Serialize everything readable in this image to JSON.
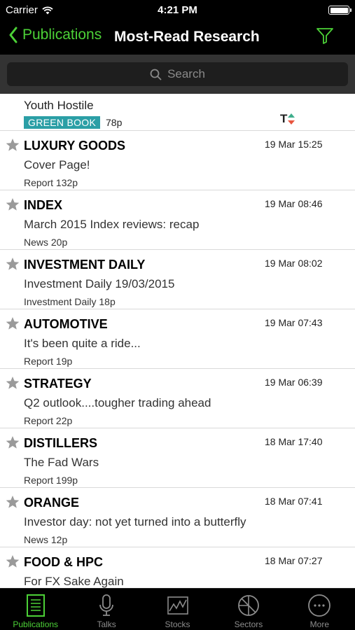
{
  "status_bar": {
    "carrier": "Carrier",
    "time": "4:21 PM"
  },
  "nav": {
    "back_label": "Publications",
    "title": "Most-Read Research"
  },
  "search": {
    "placeholder": "Search"
  },
  "first_item": {
    "title": "Youth Hostile",
    "badge": "GREEN BOOK",
    "pages": "78p",
    "marker": "T"
  },
  "items": [
    {
      "heading": "LUXURY GOODS",
      "date": "19 Mar 15:25",
      "summary": "Cover Page!",
      "meta": "Report 132p"
    },
    {
      "heading": "INDEX",
      "date": "19 Mar 08:46",
      "summary": "March 2015 Index reviews: recap",
      "meta": "News 20p"
    },
    {
      "heading": "INVESTMENT DAILY",
      "date": "19 Mar 08:02",
      "summary": "Investment Daily 19/03/2015",
      "meta": "Investment Daily 18p"
    },
    {
      "heading": "AUTOMOTIVE",
      "date": "19 Mar 07:43",
      "summary": "It's been quite a ride...",
      "meta": "Report 19p"
    },
    {
      "heading": "STRATEGY",
      "date": "19 Mar 06:39",
      "summary": "Q2 outlook....tougher trading ahead",
      "meta": "Report 22p"
    },
    {
      "heading": "DISTILLERS",
      "date": "18 Mar 17:40",
      "summary": "The Fad Wars",
      "meta": "Report 199p"
    },
    {
      "heading": "ORANGE",
      "date": "18 Mar 07:41",
      "summary": "Investor day: not yet turned into a butterfly",
      "meta": "News 12p"
    },
    {
      "heading": "FOOD & HPC",
      "date": "18 Mar 07:27",
      "summary": "For FX Sake Again",
      "meta": ""
    }
  ],
  "tabs": [
    {
      "label": "Publications",
      "icon": "publications-icon",
      "active": true
    },
    {
      "label": "Talks",
      "icon": "microphone-icon",
      "active": false
    },
    {
      "label": "Stocks",
      "icon": "stock-chart-icon",
      "active": false
    },
    {
      "label": "Sectors",
      "icon": "sectors-pie-icon",
      "active": false
    },
    {
      "label": "More",
      "icon": "more-icon",
      "active": false
    }
  ],
  "colors": {
    "accent": "#4cd137",
    "badge": "#2b9fa6",
    "star": "#9a9a9a"
  }
}
